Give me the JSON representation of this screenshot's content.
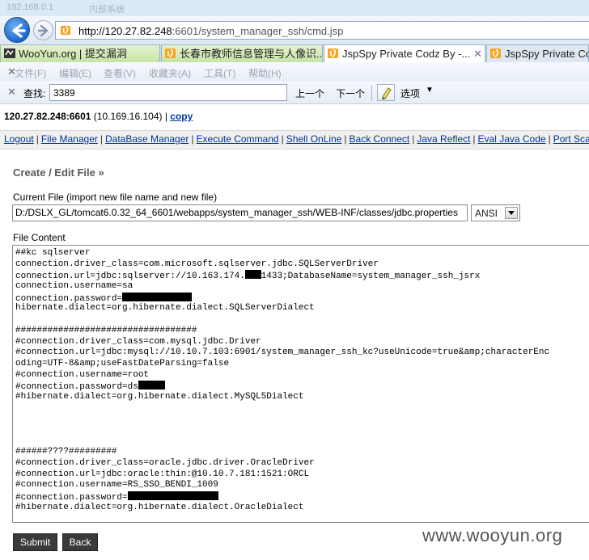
{
  "browser": {
    "title_ghost_left": "192.168.0.1",
    "title_ghost_right": "内部系统",
    "address": {
      "host": "http://120.27.82.248",
      "path": ":6601/system_manager_ssh/cmd.jsp"
    },
    "tabs": [
      {
        "label": "WooYun.org | 提交漏洞",
        "icon": "wooyun-icon",
        "style": "green"
      },
      {
        "label": "长春市教师信息管理与人像识...",
        "icon": "jsp-icon",
        "style": "green"
      },
      {
        "label": "JspSpy Private Codz By -...",
        "icon": "jsp-icon",
        "style": "active",
        "close": "✕"
      },
      {
        "label": "JspSpy Private Codz",
        "icon": "jsp-icon",
        "style": "plain"
      }
    ],
    "menu": [
      "文件(F)",
      "编辑(E)",
      "查看(V)",
      "收藏夹(A)",
      "工具(T)",
      "帮助(H)"
    ],
    "find": {
      "label": "查找:",
      "value": "3389",
      "prev": "上一个",
      "next": "下一个",
      "options": "选项"
    }
  },
  "page": {
    "host_bold": "120.27.82.248:6601",
    "host_inner": " (10.169.16.104) | ",
    "copy_link": "copy",
    "command_links": [
      "Logout",
      "File Manager",
      "DataBase Manager",
      "Execute Command",
      "Shell OnLine",
      "Back Connect",
      "Java Reflect",
      "Eval Java Code",
      "Port Scan"
    ],
    "heading": "Create / Edit File »",
    "current_file_label": "Current File (import new file name and new file)",
    "current_file_value": "D:/DSLX_GL/tomcat6.0.32_64_6601/webapps/system_manager_ssh/WEB-INF/classes/jdbc.properties",
    "encoding": "ANSI",
    "content_label": "File Content",
    "file_lines": [
      {
        "t": "##kc sqlserver"
      },
      {
        "t": "connection.driver_class=com.microsoft.sqlserver.jdbc.SQLServerDriver"
      },
      {
        "t": "connection.url=jdbc:sqlserver://10.163.174.",
        "redact": 3,
        "after": "1433;DatabaseName=system_manager_ssh_jsrx"
      },
      {
        "t": "connection.username=sa"
      },
      {
        "t": "connection.password=",
        "redact": 13
      },
      {
        "t": "hibernate.dialect=org.hibernate.dialect.SQLServerDialect"
      },
      {
        "t": ""
      },
      {
        "t": "##################################"
      },
      {
        "t": "#connection.driver_class=com.mysql.jdbc.Driver"
      },
      {
        "t": "#connection.url=jdbc:mysql://10.10.7.103:6901/system_manager_ssh_kc?useUnicode=true&amp;characterEnc"
      },
      {
        "t": "oding=UTF-8&amp;useFastDateParsing=false"
      },
      {
        "t": "#connection.username=root"
      },
      {
        "t": "#connection.password=ds",
        "redact": 5
      },
      {
        "t": "#hibernate.dialect=org.hibernate.dialect.MySQL5Dialect"
      },
      {
        "t": ""
      },
      {
        "t": ""
      },
      {
        "t": ""
      },
      {
        "t": ""
      },
      {
        "t": "######????#########"
      },
      {
        "t": "#connection.driver_class=oracle.jdbc.driver.OracleDriver"
      },
      {
        "t": "#connection.url=jdbc:oracle:thin:@10.10.7.181:1521:ORCL"
      },
      {
        "t": "#connection.username=RS_SSO_BENDI_1009"
      },
      {
        "t": "#connection.password=",
        "redact": 17
      },
      {
        "t": "#hibernate.dialect=org.hibernate.dialect.OracleDialect"
      }
    ],
    "submit": "Submit",
    "back": "Back",
    "watermark": "www.wooyun.org"
  }
}
